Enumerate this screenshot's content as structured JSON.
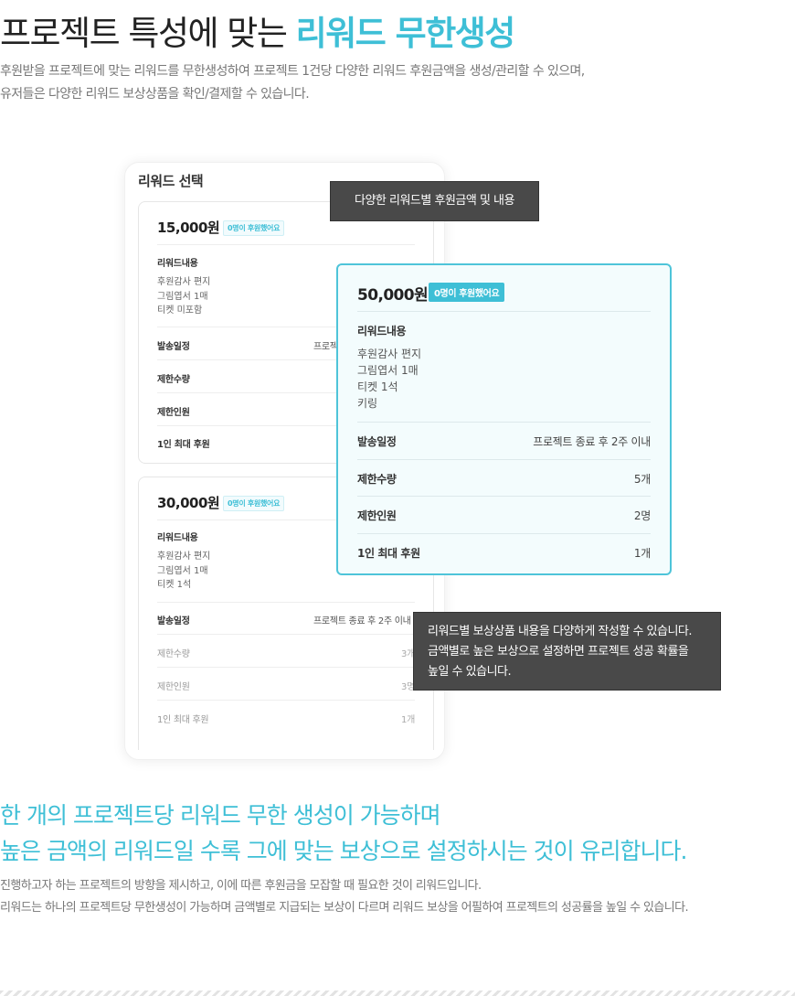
{
  "header": {
    "title_plain": "프로젝트 특성에 맞는 ",
    "title_accent": "리워드 무한생성",
    "intro_line1": "후원받을 프로젝트에 맞는 리워드를 무한생성하여 프로젝트 1건당 다양한 리워드 후원금액을 생성/관리할 수 있으며,",
    "intro_line2": "유저들은 다양한 리워드 보상상품을 확인/결제할 수 있습니다."
  },
  "panel": {
    "title": "리워드 선택",
    "cards": [
      {
        "price": "15,000원",
        "badge": "0명이 후원했어요",
        "content_label": "리워드내용",
        "items": [
          "후원감사 편지",
          "그림엽서 1매",
          "티켓 미포함"
        ],
        "rows": [
          {
            "label": "발송일정",
            "value": "프로젝"
          },
          {
            "label": "제한수량",
            "value": ""
          },
          {
            "label": "제한인원",
            "value": ""
          },
          {
            "label": "1인 최대 후원",
            "value": ""
          }
        ]
      },
      {
        "price": "30,000원",
        "badge": "0명이 후원했어요",
        "content_label": "리워드내용",
        "items": [
          "후원감사 편지",
          "그림엽서 1매",
          "티켓 1석"
        ],
        "rows": [
          {
            "label": "발송일정",
            "value": "프로젝트 종료 후 2주 이내"
          },
          {
            "label": "제한수량",
            "value": "3개"
          },
          {
            "label": "제한인원",
            "value": "3명"
          },
          {
            "label": "1인 최대 후원",
            "value": "1개"
          }
        ]
      }
    ]
  },
  "featured": {
    "price": "50,000원",
    "badge": "0명이 후원했어요",
    "content_label": "리워드내용",
    "items": [
      "후원감사 편지",
      "그림엽서 1매",
      "티켓 1석",
      "키링"
    ],
    "rows": [
      {
        "label": "발송일정",
        "value": "프로젝트 종료 후 2주 이내"
      },
      {
        "label": "제한수량",
        "value": "5개"
      },
      {
        "label": "제한인원",
        "value": "2명"
      },
      {
        "label": "1인 최대 후원",
        "value": "1개"
      }
    ]
  },
  "tooltips": {
    "tip1": "다양한 리워드별 후원금액 및 내용",
    "tip2_line1": "리워드별 보상상품 내용을 다양하게 작성할 수 있습니다.",
    "tip2_line2": "금액별로 높은 보상으로 설정하면 프로젝트 성공 확률을",
    "tip2_line3": "높일 수 있습니다."
  },
  "section2": {
    "heading_line1": "한 개의 프로젝트당 리워드 무한 생성이 가능하며",
    "heading_line2": "높은 금액의 리워드일 수록 그에 맞는 보상으로 설정하시는 것이 유리합니다.",
    "desc_line1": "진행하고자 하는 프로젝트의 방향을 제시하고, 이에 따른 후원금을 모잡할 때 필요한 것이 리워드입니다.",
    "desc_line2": "리워드는 하나의 프로젝트당 무한생성이 가능하며 금액별로 지급되는 보상이 다르며 리워드 보상을 어필하여 프로젝트의 성공률을 높일 수 있습니다."
  },
  "colors": {
    "accent": "#3ebfd6",
    "tooltip_bg": "#494949"
  }
}
